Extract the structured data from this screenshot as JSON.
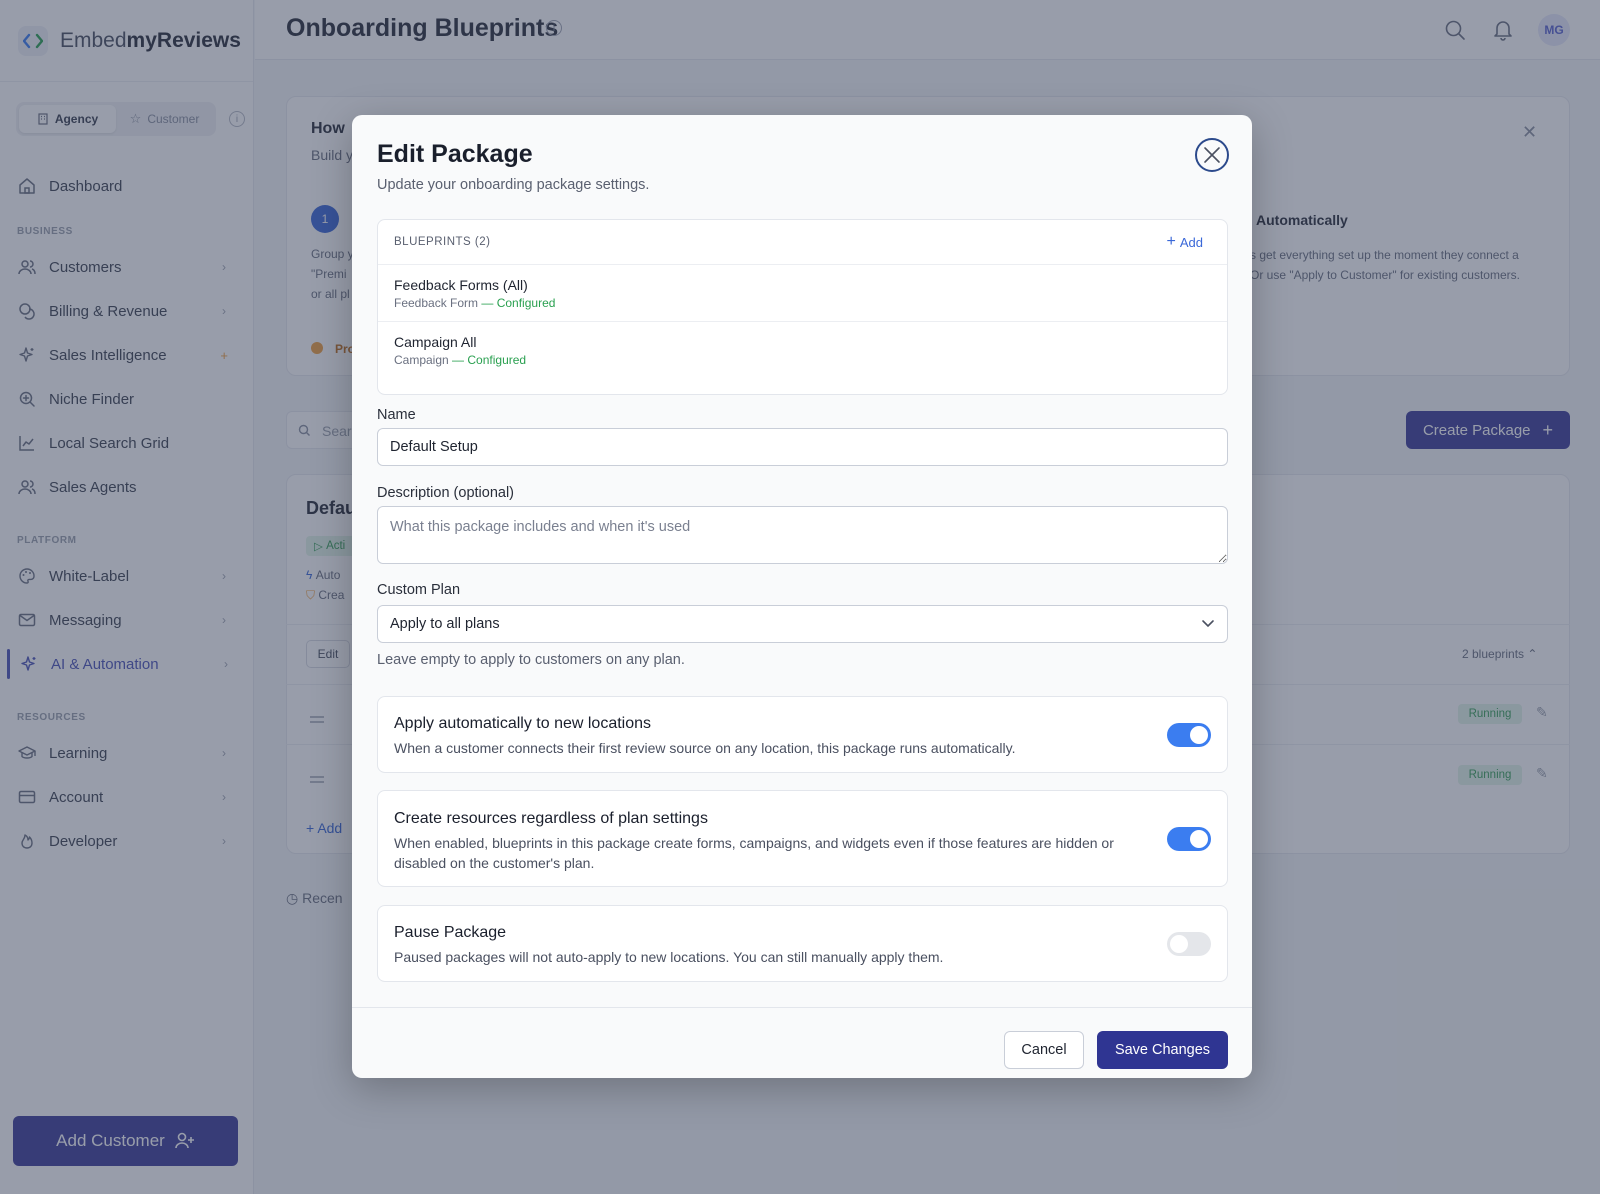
{
  "brand": {
    "prefix": "Embed",
    "bold": "myReviews"
  },
  "sidebar": {
    "mode": {
      "agency": "Agency",
      "customer": "Customer"
    },
    "dashboard": "Dashboard",
    "sections": {
      "business": "BUSINESS",
      "platform": "PLATFORM",
      "resources": "RESOURCES"
    },
    "business_items": [
      {
        "label": "Customers",
        "icon": "users-icon"
      },
      {
        "label": "Billing & Revenue",
        "icon": "coins-icon"
      },
      {
        "label": "Sales Intelligence",
        "icon": "sparkles-icon"
      },
      {
        "label": "Niche Finder",
        "icon": "search-plus-icon"
      },
      {
        "label": "Local Search Grid",
        "icon": "chart-line-icon"
      },
      {
        "label": "Sales Agents",
        "icon": "users-icon"
      }
    ],
    "platform_items": [
      {
        "label": "White-Label",
        "icon": "palette-icon"
      },
      {
        "label": "Messaging",
        "icon": "mail-icon"
      },
      {
        "label": "AI & Automation",
        "icon": "sparkles-icon"
      }
    ],
    "resources_items": [
      {
        "label": "Learning",
        "icon": "graduation-cap-icon"
      },
      {
        "label": "Account",
        "icon": "credit-card-icon"
      },
      {
        "label": "Developer",
        "icon": "flame-icon"
      }
    ],
    "add_customer": "Add Customer"
  },
  "header": {
    "title": "Onboarding Blueprints",
    "avatar": "MG"
  },
  "background": {
    "how_title": "How",
    "how_sub": "Build y",
    "step_number": "1",
    "step_text_1": "Group y",
    "step_text_2": "\"Premi",
    "step_text_3": "or all pl",
    "auto_title": "Automatically",
    "auto_text_1": "s get everything set up the moment they connect a",
    "auto_text_2": "Or use \"Apply to Customer\" for existing customers.",
    "pro_tip": "Pro",
    "search_placeholder": "Sear",
    "create_package": "Create Package",
    "default_title": "Defau",
    "active_badge": "Acti",
    "auto_line": "Auto",
    "create_line": "Crea",
    "edit_button": "Edit",
    "blueprints_count": "2 blueprints",
    "running": "Running",
    "add_link": "Add",
    "recent": "Recen"
  },
  "modal": {
    "title": "Edit Package",
    "subtitle": "Update your onboarding package settings.",
    "blueprints": {
      "heading": "BLUEPRINTS (2)",
      "add": "Add",
      "items": [
        {
          "name": "Feedback Forms (All)",
          "type": "Feedback Form",
          "status": "— Configured"
        },
        {
          "name": "Campaign All",
          "type": "Campaign",
          "status": "— Configured"
        }
      ]
    },
    "name_label": "Name",
    "name_value": "Default Setup",
    "description_label": "Description (optional)",
    "description_placeholder": "What this package includes and when it's used",
    "plan_label": "Custom Plan",
    "plan_value": "Apply to all plans",
    "plan_help": "Leave empty to apply to customers on any plan.",
    "toggles": [
      {
        "title": "Apply automatically to new locations",
        "desc": "When a customer connects their first review source on any location, this package runs automatically.",
        "on": true
      },
      {
        "title": "Create resources regardless of plan settings",
        "desc": "When enabled, blueprints in this package create forms, campaigns, and widgets even if those features are hidden or disabled on the customer's plan.",
        "on": true
      },
      {
        "title": "Pause Package",
        "desc": "Paused packages will not auto-apply to new locations. You can still manually apply them.",
        "on": false
      }
    ],
    "cancel": "Cancel",
    "save": "Save Changes"
  },
  "colors": {
    "accent": "#3b7df0",
    "primary_button": "#2f3592",
    "configured": "#2aa050"
  }
}
